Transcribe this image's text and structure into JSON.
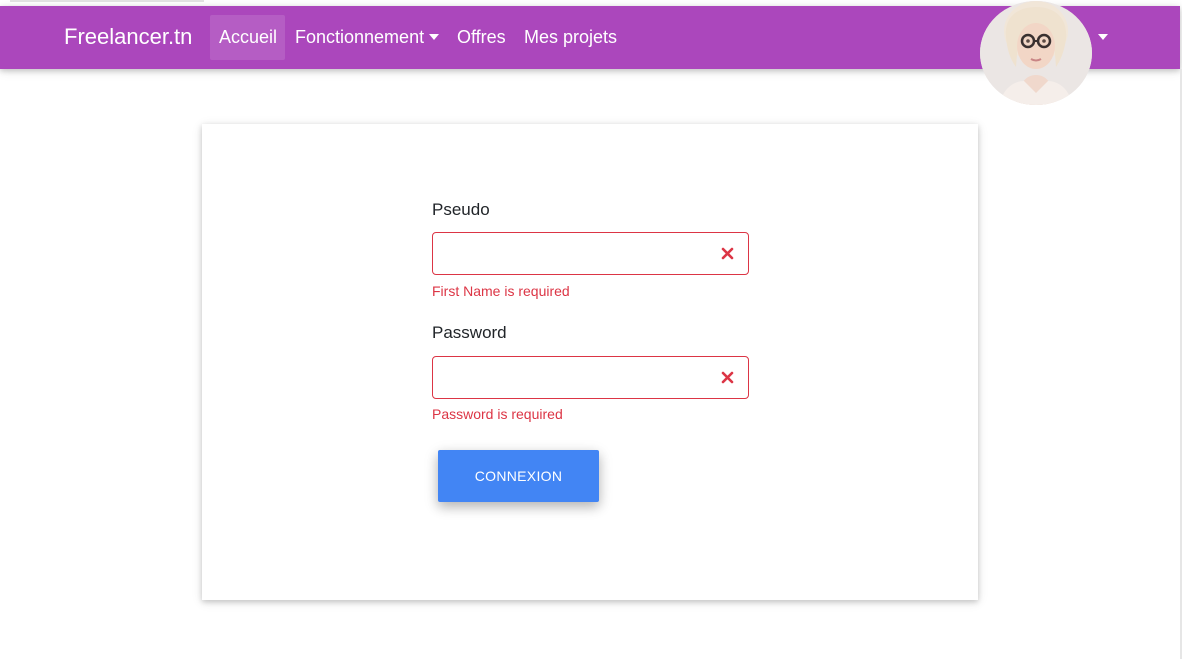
{
  "navbar": {
    "brand": "Freelancer.tn",
    "links": [
      {
        "label": "Accueil",
        "active": true
      },
      {
        "label": "Fonctionnement",
        "dropdown": true
      },
      {
        "label": "Offres"
      },
      {
        "label": "Mes projets"
      }
    ],
    "user_avatar_icon": "user-avatar-photo",
    "avatar_dropdown_icon": "caret-down-icon"
  },
  "form": {
    "pseudo": {
      "label": "Pseudo",
      "value": "",
      "error": "First Name is required"
    },
    "password": {
      "label": "Password",
      "value": "",
      "error": "Password is required"
    },
    "submit_label": "CONNEXION",
    "invalid_icon": "x-mark-icon"
  },
  "colors": {
    "navbar": "#ab47bc",
    "button": "#4285f4",
    "error": "#dc3545"
  }
}
